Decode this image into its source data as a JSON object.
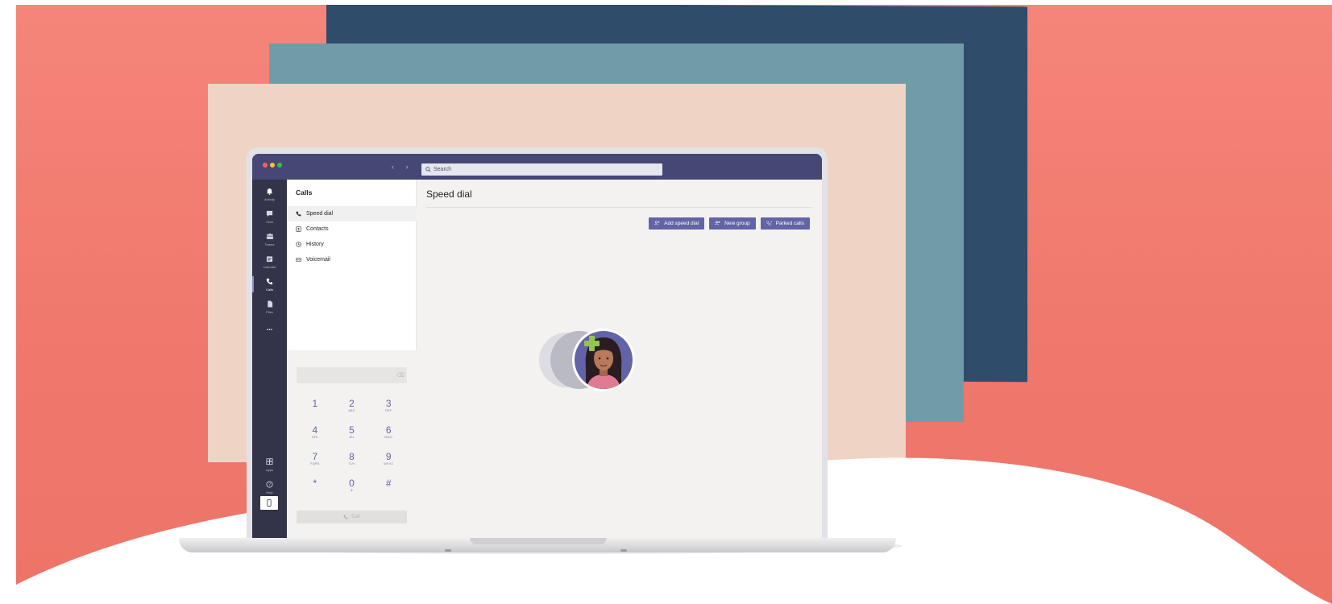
{
  "window": {
    "search_placeholder": "Search",
    "nav_arrows": "‹ ›"
  },
  "rail": {
    "items": [
      {
        "label": "Activity",
        "icon": "bell-icon"
      },
      {
        "label": "Chat",
        "icon": "chat-icon"
      },
      {
        "label": "Teams",
        "icon": "teams-icon"
      },
      {
        "label": "Calendar",
        "icon": "calendar-icon"
      },
      {
        "label": "Calls",
        "icon": "phone-icon",
        "active": true
      },
      {
        "label": "Files",
        "icon": "files-icon"
      },
      {
        "label": "...",
        "icon": "more-icon"
      }
    ],
    "bottom": [
      {
        "label": "Apps",
        "icon": "apps-icon"
      },
      {
        "label": "Help",
        "icon": "help-icon"
      }
    ]
  },
  "calls": {
    "title": "Calls",
    "nav": [
      {
        "label": "Speed dial",
        "icon": "phone-icon",
        "active": true
      },
      {
        "label": "Contacts",
        "icon": "contacts-icon"
      },
      {
        "label": "History",
        "icon": "clock-icon"
      },
      {
        "label": "Voicemail",
        "icon": "voicemail-icon"
      }
    ],
    "keypad": [
      {
        "digit": "1",
        "sub": ""
      },
      {
        "digit": "2",
        "sub": "ABC"
      },
      {
        "digit": "3",
        "sub": "DEF"
      },
      {
        "digit": "4",
        "sub": "GHI"
      },
      {
        "digit": "5",
        "sub": "JKL"
      },
      {
        "digit": "6",
        "sub": "MNO"
      },
      {
        "digit": "7",
        "sub": "PQRS"
      },
      {
        "digit": "8",
        "sub": "TUV"
      },
      {
        "digit": "9",
        "sub": "WXYZ"
      },
      {
        "digit": "*",
        "sub": ""
      },
      {
        "digit": "0",
        "sub": "+"
      },
      {
        "digit": "#",
        "sub": ""
      }
    ],
    "call_label": "Call"
  },
  "main": {
    "title": "Speed dial",
    "actions": [
      {
        "label": "Add speed dial",
        "icon": "add-person-icon"
      },
      {
        "label": "New group",
        "icon": "add-group-icon"
      },
      {
        "label": "Parked calls",
        "icon": "parked-call-icon"
      }
    ]
  },
  "colors": {
    "brand": "#6264a7",
    "titlebar": "#464775",
    "rail": "#33344a",
    "background_coral": "#f07b70"
  }
}
